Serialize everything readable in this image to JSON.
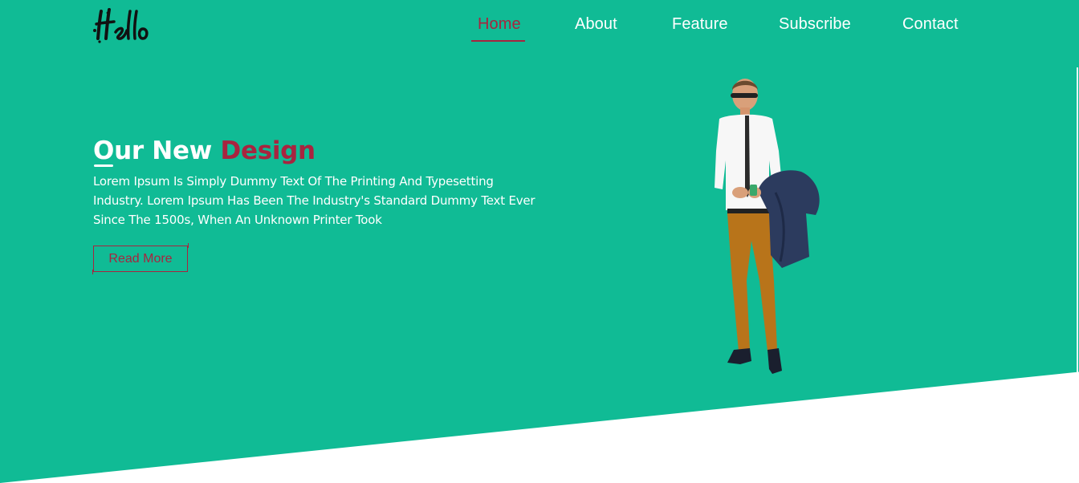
{
  "brand": {
    "logo_text": "Hello"
  },
  "nav": {
    "items": [
      {
        "label": "Home",
        "active": true
      },
      {
        "label": "About",
        "active": false
      },
      {
        "label": "Feature",
        "active": false
      },
      {
        "label": "Subscribe",
        "active": false
      },
      {
        "label": "Contact",
        "active": false
      }
    ]
  },
  "hero": {
    "title_first_letter": "O",
    "title_rest": "ur New",
    "title_accent": "Design",
    "description": "Lorem Ipsum Is Simply Dummy Text Of The Printing And Typesetting Industry. Lorem Ipsum Has Been The Industry's Standard Dummy Text Ever Since The 1500s, When An Unknown Printer Took",
    "button_label": "Read More"
  },
  "colors": {
    "background": "#10bb95",
    "accent": "#a8243f",
    "text": "#ffffff",
    "page": "#ffffff"
  }
}
